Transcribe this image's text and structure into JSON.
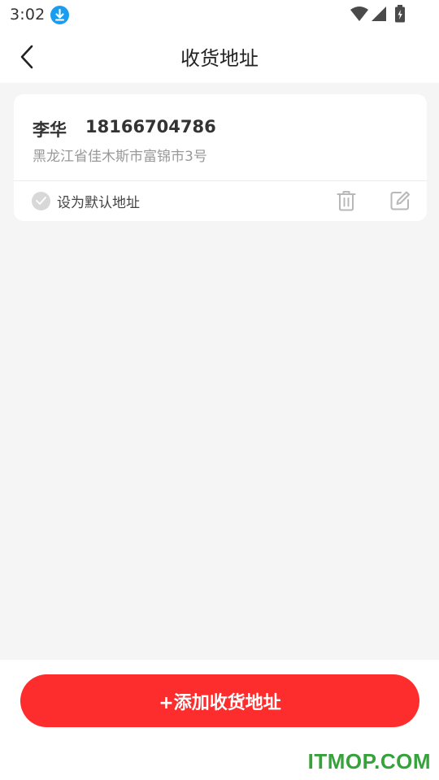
{
  "status_bar": {
    "time": "3:02",
    "icons": [
      "download-icon",
      "wifi-icon",
      "signal-icon",
      "battery-icon"
    ]
  },
  "header": {
    "back_icon": "chevron-left-icon",
    "title": "收货地址"
  },
  "addresses": [
    {
      "name": "李华",
      "phone": "18166704786",
      "address": "黑龙江省佳木斯市富锦市3号",
      "default_label": "设为默认地址",
      "is_default": false,
      "actions": [
        "trash-icon",
        "edit-icon"
      ]
    }
  ],
  "footer": {
    "add_button_label": "+添加收货地址"
  },
  "watermark": "ITMOP.COM",
  "colors": {
    "accent": "#fd2d2d",
    "background": "#f5f5f5",
    "download_badge": "#1a9df0",
    "watermark": "#35a23a"
  }
}
